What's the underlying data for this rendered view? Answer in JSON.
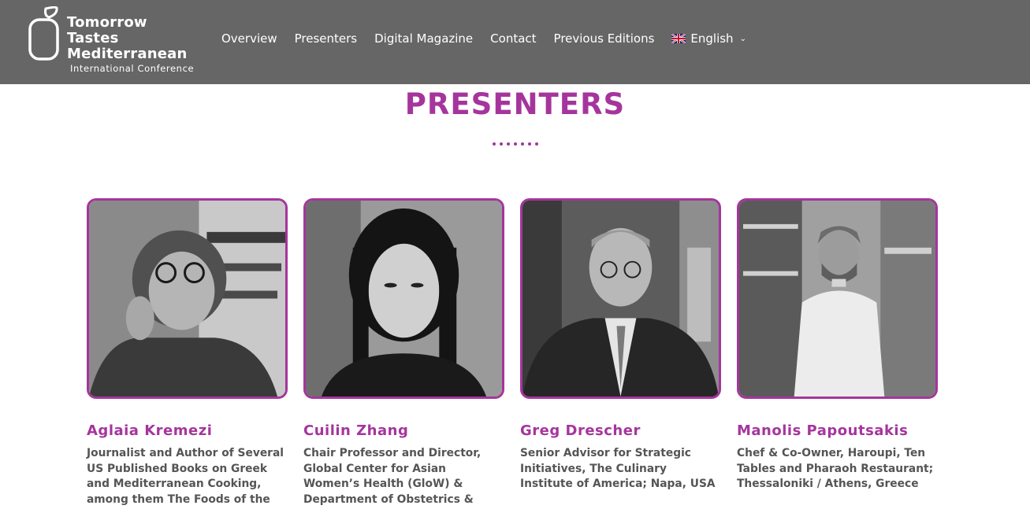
{
  "brand": {
    "line1": "Tomorrow",
    "line2": "Tastes",
    "line3": "Mediterranean",
    "subtitle": "International Conference"
  },
  "nav": {
    "items": [
      "Overview",
      "Presenters",
      "Digital Magazine",
      "Contact",
      "Previous Editions"
    ],
    "language": "English"
  },
  "page": {
    "title": "PRESENTERS"
  },
  "presenters": [
    {
      "name": "Aglaia Kremezi",
      "role": "Journalist and Author of Several US Published Books on Greek and Mediterranean Cooking, among them The Foods of the Greek"
    },
    {
      "name": "Cuilin Zhang",
      "role": "Chair Professor and Director, Global Center for Asian Women’s Health (GloW) & Department of Obstetrics & Gynecology, Yong Loo Lin School"
    },
    {
      "name": "Greg Drescher",
      "role": "Senior Advisor for Strategic Initiatives, The Culinary Institute of America; Napa, USA"
    },
    {
      "name": "Manolis Papoutsakis",
      "role": "Chef & Co-Owner, Haroupi, Ten Tables and Pharaoh Restaurant; Thessaloniki / Athens, Greece"
    }
  ],
  "colors": {
    "accent": "#a5359c",
    "header_bg": "#666666",
    "body_text": "#555555"
  }
}
